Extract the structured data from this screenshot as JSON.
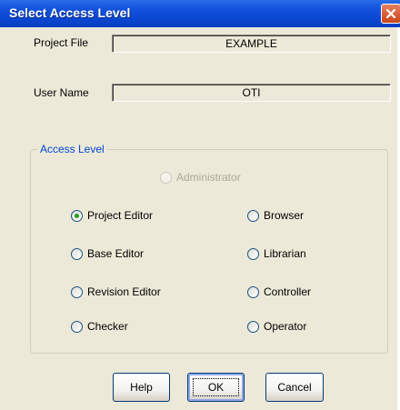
{
  "window": {
    "title": "Select Access Level"
  },
  "project_file": {
    "label": "Project File",
    "value": "EXAMPLE"
  },
  "user_name": {
    "label": "User Name",
    "value": "OTI"
  },
  "access_level": {
    "legend": "Access Level",
    "administrator": "Administrator",
    "options": {
      "project_editor": "Project Editor",
      "browser": "Browser",
      "base_editor": "Base Editor",
      "librarian": "Librarian",
      "revision_editor": "Revision Editor",
      "controller": "Controller",
      "checker": "Checker",
      "operator": "Operator"
    },
    "selected": "Project Editor"
  },
  "buttons": {
    "help": "Help",
    "ok": "OK",
    "cancel": "Cancel"
  },
  "colors": {
    "title_bar": "#0b46d0",
    "client_bg": "#ece9d8",
    "group_legend": "#0046d5",
    "radio_selected": "#21a121"
  }
}
